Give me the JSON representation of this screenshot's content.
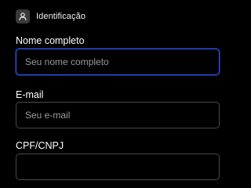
{
  "section": {
    "title": "Identificação",
    "icon": "user-icon"
  },
  "fields": [
    {
      "label": "Nome completo",
      "placeholder": "Seu nome completo",
      "value": "",
      "focused": true
    },
    {
      "label": "E-mail",
      "placeholder": "Seu e-mail",
      "value": ""
    },
    {
      "label": "CPF/CNPJ",
      "placeholder": "",
      "value": ""
    }
  ],
  "colors": {
    "background": "#000000",
    "focus_border": "#2d5bff",
    "input_border": "#4a4a4e",
    "placeholder": "#9a9aa0"
  }
}
